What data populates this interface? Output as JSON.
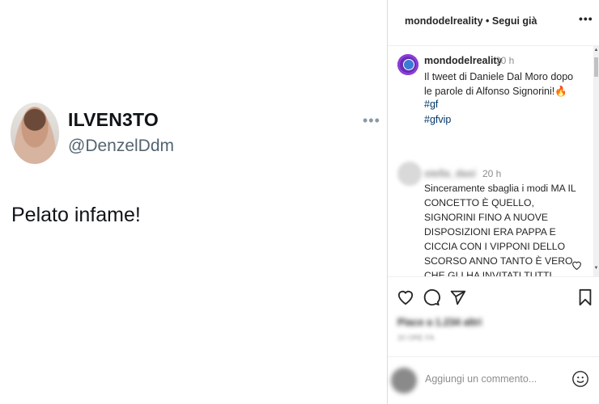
{
  "tweet": {
    "display_name": "ILVEN3TO",
    "handle": "@DenzelDdm",
    "text": "Pelato infame!",
    "more_icon": "more-horizontal-icon"
  },
  "instagram": {
    "header": {
      "username": "mondodelreality",
      "separator": "•",
      "follow_label": "Segui già",
      "more_icon": "more-horizontal-icon"
    },
    "caption": {
      "username": "mondodelreality",
      "time": "20 h",
      "text": "Il tweet di Daniele Dal Moro dopo le parole di Alfonso Signorini!",
      "emoji": "🔥",
      "hashtags": [
        "#gf",
        "#gfvip"
      ]
    },
    "comment": {
      "username": "stella_dasi",
      "time": "20 h",
      "text": "Sinceramente sbaglia i modi MA IL CONCETTO È QUELLO, SIGNORINI FINO A NUOVE DISPOSIZIONI ERA PAPPA E CICCIA CON I VIPPONI DELLO SCORSO ANNO TANTO È VERO CHE GLI HA INVITATI TUTTI"
    },
    "actions": {
      "like_icon": "heart-icon",
      "comment_icon": "comment-icon",
      "share_icon": "send-icon",
      "save_icon": "bookmark-icon"
    },
    "likes_text": "Piace a 1.234 altri",
    "date_text": "20 ORE FA",
    "add_comment_placeholder": "Aggiungi un commento...",
    "emoji_icon": "smiley-icon",
    "colors": {
      "hashtag": "#00376b",
      "text": "#262626",
      "muted": "#8e8e8e",
      "avatar_ring": "#6a2bb5"
    }
  }
}
